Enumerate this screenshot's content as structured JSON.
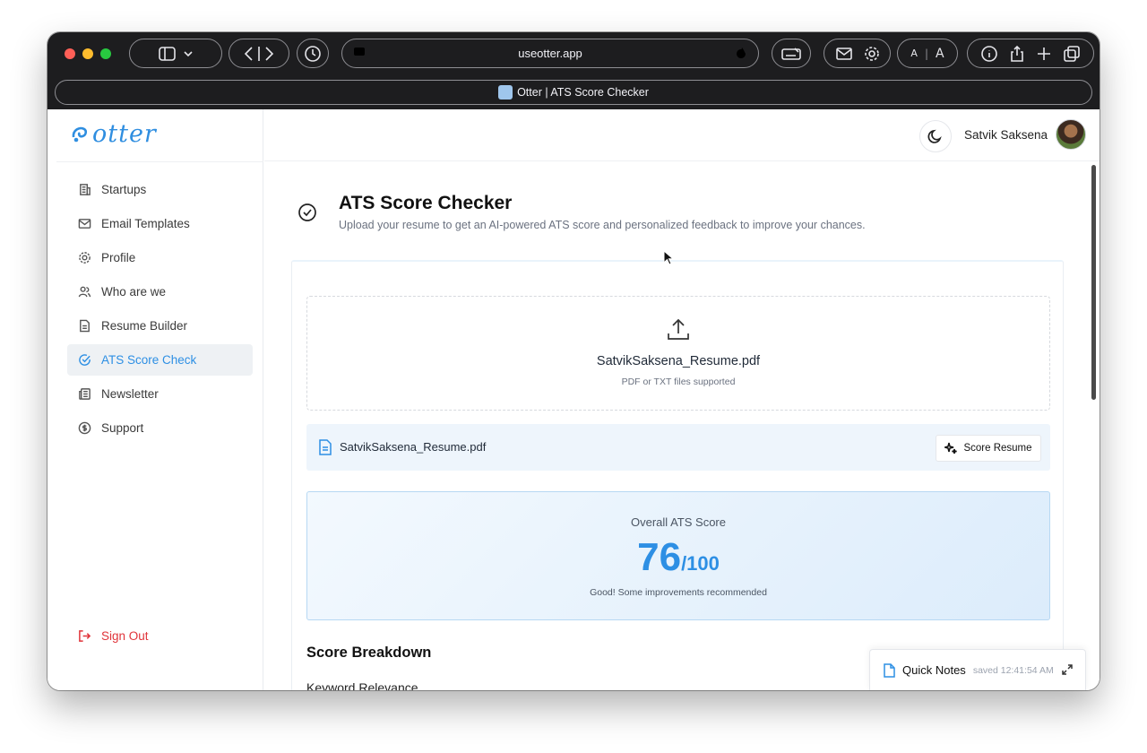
{
  "browser": {
    "url": "useotter.app",
    "tab_title": "Otter | ATS Score Checker",
    "zoom_small": "A",
    "zoom_large": "A"
  },
  "brand": {
    "name": "otter",
    "color": "#2f8ee0"
  },
  "sidebar": {
    "items": [
      {
        "label": "Startups",
        "icon": "building-icon",
        "active": false
      },
      {
        "label": "Email Templates",
        "icon": "mail-icon",
        "active": false
      },
      {
        "label": "Profile",
        "icon": "gear-icon",
        "active": false
      },
      {
        "label": "Who are we",
        "icon": "users-icon",
        "active": false
      },
      {
        "label": "Resume Builder",
        "icon": "document-icon",
        "active": false
      },
      {
        "label": "ATS Score Check",
        "icon": "check-circle-icon",
        "active": true
      },
      {
        "label": "Newsletter",
        "icon": "newspaper-icon",
        "active": false
      },
      {
        "label": "Support",
        "icon": "support-icon",
        "active": false
      }
    ],
    "signout_label": "Sign Out"
  },
  "header": {
    "user_name": "Satvik Saksena"
  },
  "page": {
    "title": "ATS Score Checker",
    "subtitle": "Upload your resume to get an AI-powered ATS score and personalized feedback to improve your chances."
  },
  "upload": {
    "file_name": "SatvikSaksena_Resume.pdf",
    "hint": "PDF or TXT files supported"
  },
  "file_row": {
    "file_name": "SatvikSaksena_Resume.pdf",
    "score_button": "Score Resume"
  },
  "score": {
    "label": "Overall ATS Score",
    "value": "76",
    "max": "/100",
    "message": "Good! Some improvements recommended"
  },
  "breakdown": {
    "title": "Score Breakdown",
    "first_item": "Keyword Relevance"
  },
  "quick_notes": {
    "title": "Quick Notes",
    "saved": "saved 12:41:54 AM"
  },
  "colors": {
    "accent": "#2d8fe4",
    "danger": "#e0343a",
    "active_bg": "#eef1f4"
  }
}
